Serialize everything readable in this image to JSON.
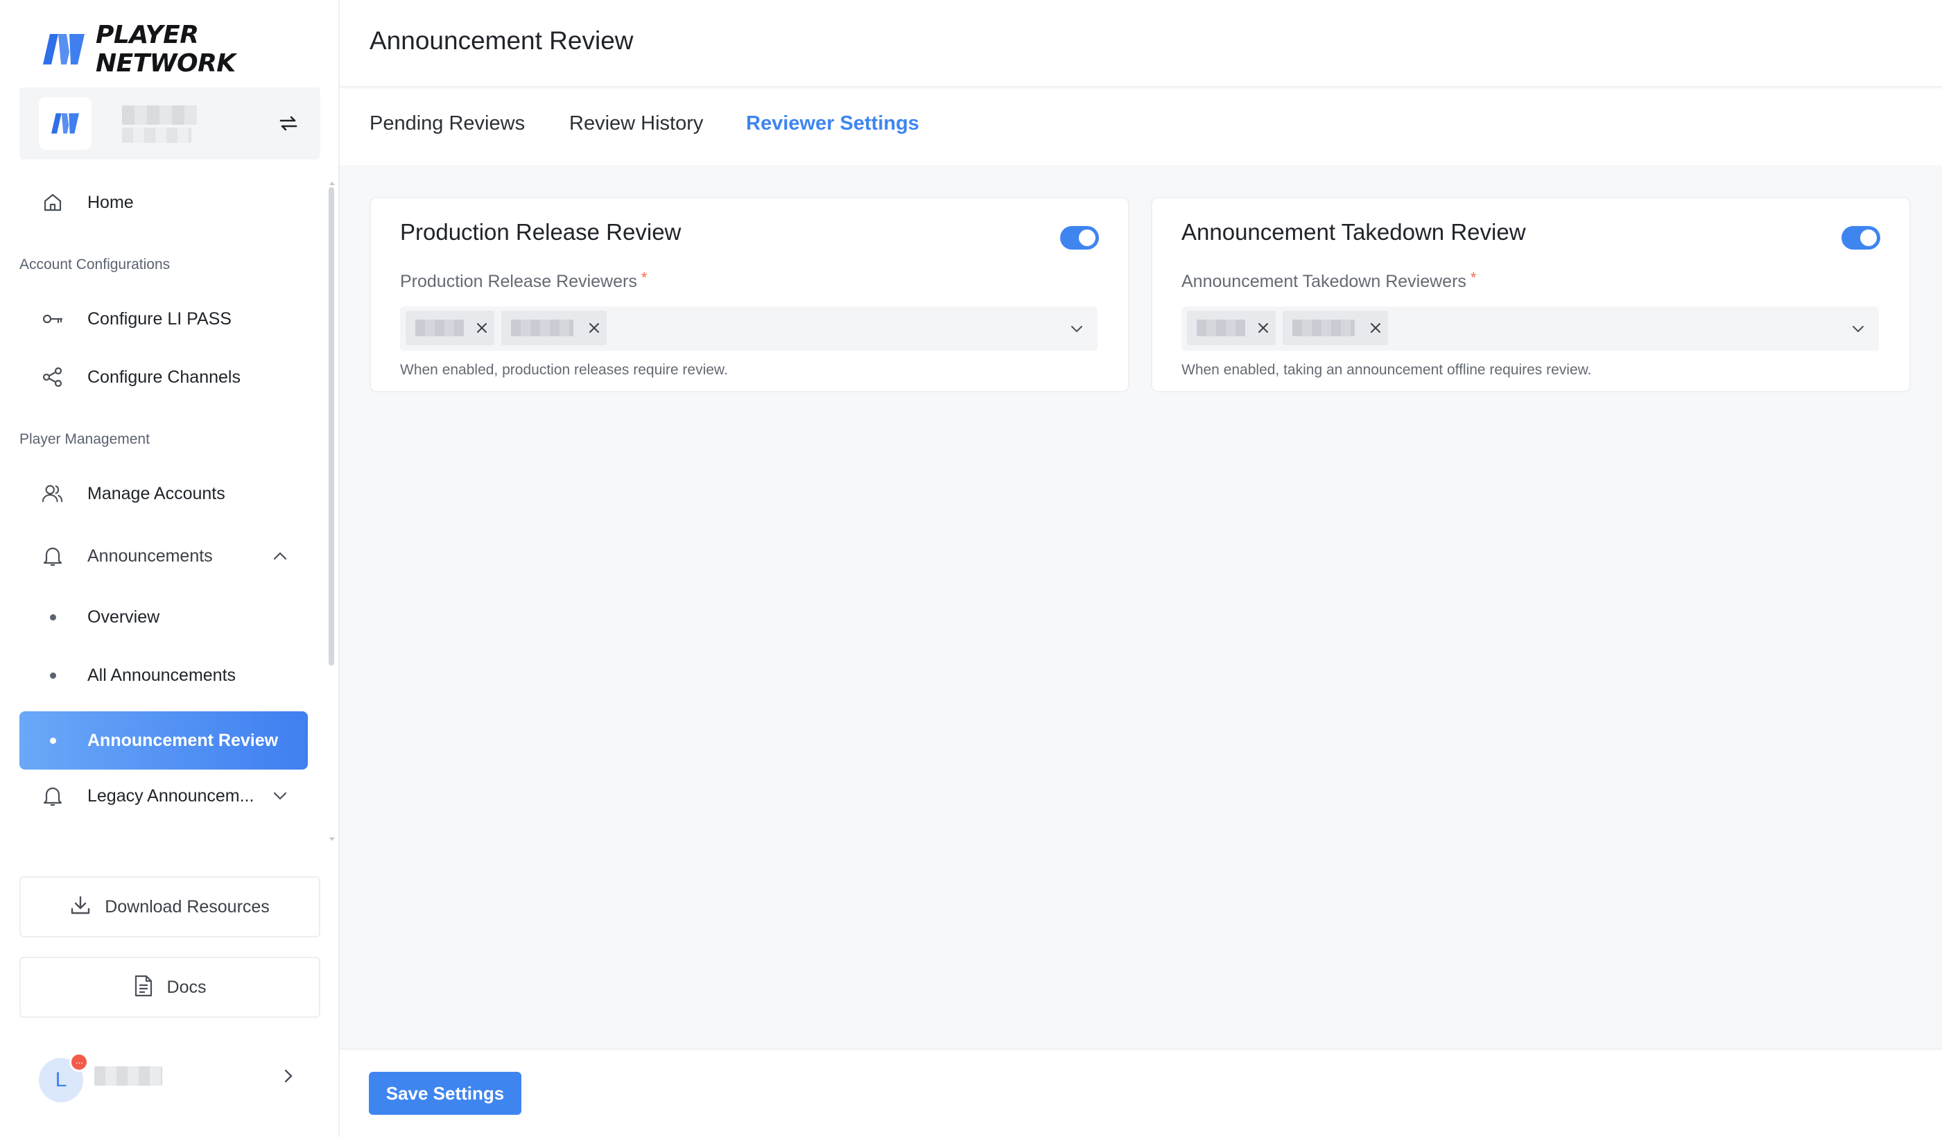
{
  "app": {
    "brand": "PLAYER NETWORK",
    "accent_color": "#3f85f0"
  },
  "workspace": {
    "name": "",
    "sub": ""
  },
  "sidebar": {
    "home": "Home",
    "section_account": "Account Configurations",
    "configure_li_pass": "Configure LI PASS",
    "configure_channels": "Configure Channels",
    "section_player": "Player Management",
    "manage_accounts": "Manage Accounts",
    "announcements": "Announcements",
    "overview": "Overview",
    "all_announcements": "All Announcements",
    "announcement_review": "Announcement Review",
    "legacy_announcements": "Legacy Announcem...",
    "download_resources": "Download Resources",
    "docs": "Docs"
  },
  "user": {
    "initial": "L",
    "badge": "···",
    "name": ""
  },
  "page": {
    "title": "Announcement Review"
  },
  "tabs": [
    {
      "label": "Pending Reviews",
      "active": false
    },
    {
      "label": "Review History",
      "active": false
    },
    {
      "label": "Reviewer Settings",
      "active": true
    }
  ],
  "cards": [
    {
      "title": "Production Release Review",
      "enabled": true,
      "field_label": "Production Release Reviewers",
      "required_mark": "*",
      "hint": "When enabled, production releases require review."
    },
    {
      "title": "Announcement Takedown Review",
      "enabled": true,
      "field_label": "Announcement Takedown Reviewers",
      "required_mark": "*",
      "hint": "When enabled, taking an announcement offline requires review."
    }
  ],
  "footer": {
    "save_label": "Save Settings"
  }
}
